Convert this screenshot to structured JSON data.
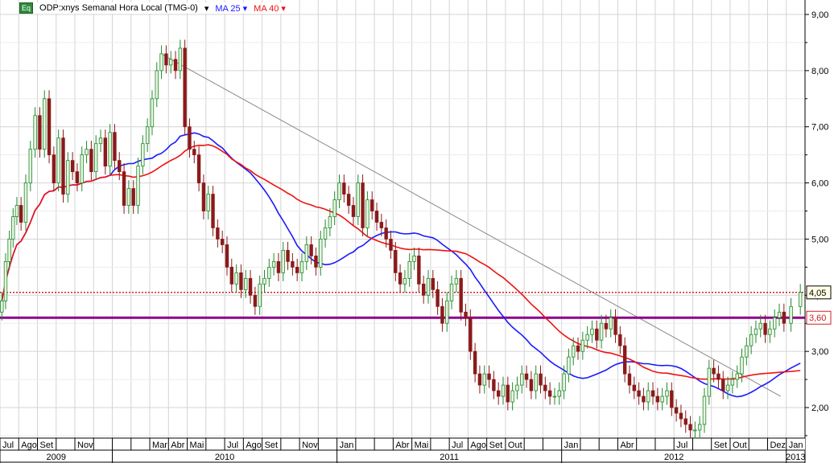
{
  "legend": {
    "badge": "Eq",
    "symbol": "ODP:xnys Semanal Hora Local (TMG-0)",
    "ma1": "MA 25 ▾",
    "ma2": "MA 40 ▾",
    "dropdown": "▾"
  },
  "colors": {
    "ma25": "#1a1aff",
    "ma40": "#ee1111",
    "bull": "#1f8a2a",
    "bear": "#8b1a1a",
    "support": "#8b008b",
    "last": "#cc2222",
    "trend": "#888888"
  },
  "chart_data": {
    "type": "candlestick",
    "title": "ODP:xnys Semanal Hora Local (TMG-0)",
    "ylim": [
      1.4,
      9.3
    ],
    "y_ticks": [
      "2,00",
      "3,00",
      "4,00",
      "5,00",
      "6,00",
      "7,00",
      "8,00",
      "9,00"
    ],
    "y_tick_values": [
      2,
      3,
      4,
      5,
      6,
      7,
      8,
      9
    ],
    "months": [
      "Jul",
      "Ago",
      "Set",
      "",
      "Nov",
      "",
      "",
      "",
      "Mar",
      "Abr",
      "Mai",
      "",
      "Jul",
      "Ago",
      "Set",
      "",
      "Nov",
      "",
      "Jan",
      "",
      "",
      "Abr",
      "Mai",
      "",
      "Jul",
      "Ago",
      "Set",
      "Out",
      "",
      "",
      "Jan",
      "",
      "",
      "Abr",
      "",
      "",
      "Jul",
      "",
      "Set",
      "Out",
      "",
      "Dez",
      "Jan"
    ],
    "years": [
      {
        "label": "2009",
        "months": 6
      },
      {
        "label": "2010",
        "months": 12
      },
      {
        "label": "2011",
        "months": 12
      },
      {
        "label": "2012",
        "months": 12
      },
      {
        "label": "2013",
        "months": 1
      }
    ],
    "weekly_close_by_month": [
      [
        3.9,
        4.6,
        5.0,
        5.4,
        5.6
      ],
      [
        5.3,
        6.0,
        6.6,
        7.2
      ],
      [
        6.6,
        7.5,
        6.5,
        6.0
      ],
      [
        6.8,
        5.8,
        6.4,
        6.2
      ],
      [
        6.0,
        6.5,
        6.6,
        6.2
      ],
      [
        6.7,
        6.8,
        6.3,
        6.9
      ],
      [
        6.4,
        6.2,
        5.6,
        5.9
      ],
      [
        5.6,
        6.3,
        6.7,
        7.0
      ],
      [
        7.5,
        8.0,
        8.3,
        8.1
      ],
      [
        8.2,
        8.0,
        8.4,
        7.0
      ],
      [
        6.6,
        6.5,
        6.0,
        5.5
      ],
      [
        5.8,
        5.2,
        5.0,
        4.9
      ],
      [
        4.5,
        4.2,
        4.4,
        4.1
      ],
      [
        4.3,
        4.0,
        3.8,
        4.2
      ],
      [
        4.3,
        4.5,
        4.6,
        4.4
      ],
      [
        4.8,
        4.6,
        4.5,
        4.4
      ],
      [
        4.6,
        4.9,
        4.7,
        4.5
      ],
      [
        5.0,
        5.2,
        5.4,
        5.7
      ],
      [
        6.0,
        5.8,
        5.6,
        5.4
      ],
      [
        6.0,
        5.2,
        5.7,
        5.5
      ],
      [
        5.3,
        5.2,
        5.0,
        4.8
      ],
      [
        4.4,
        4.2,
        4.3,
        4.6
      ],
      [
        4.7,
        4.2,
        4.0,
        4.3
      ],
      [
        4.1,
        3.8,
        3.5,
        3.9
      ],
      [
        4.2,
        4.3,
        3.7,
        3.6
      ],
      [
        3.0,
        2.6,
        2.4,
        2.6
      ],
      [
        2.5,
        2.3,
        2.2,
        2.4
      ],
      [
        2.1,
        2.3,
        2.4,
        2.6
      ],
      [
        2.5,
        2.3,
        2.6,
        2.4
      ],
      [
        2.3,
        2.2,
        2.2,
        2.3
      ],
      [
        2.6,
        2.9,
        3.1,
        3.0
      ],
      [
        3.2,
        3.3,
        3.4,
        3.2
      ],
      [
        3.5,
        3.4,
        3.6,
        3.3
      ],
      [
        3.1,
        2.6,
        2.4,
        2.3
      ],
      [
        2.2,
        2.1,
        2.3,
        2.2
      ],
      [
        2.1,
        2.2,
        2.3,
        2.0
      ],
      [
        1.9,
        1.8,
        1.7,
        1.6
      ],
      [
        1.6,
        1.7,
        2.2,
        2.7
      ],
      [
        2.6,
        2.5,
        2.3,
        2.4
      ],
      [
        2.5,
        2.6,
        2.9,
        3.1
      ],
      [
        3.3,
        3.4,
        3.5,
        3.3
      ],
      [
        3.4,
        3.6,
        3.7,
        3.5
      ],
      [
        3.8,
        4.05
      ]
    ],
    "series": [
      {
        "name": "MA 25",
        "period": 25
      },
      {
        "name": "MA 40",
        "period": 40
      }
    ],
    "last_price": {
      "value": 4.05,
      "label": "4,05"
    },
    "support_line": {
      "value": 3.6,
      "label": "3,60"
    },
    "trendline": {
      "from": {
        "month": 8.6,
        "price": 8.3
      },
      "to": {
        "month": 41.7,
        "price": 2.2
      }
    }
  }
}
